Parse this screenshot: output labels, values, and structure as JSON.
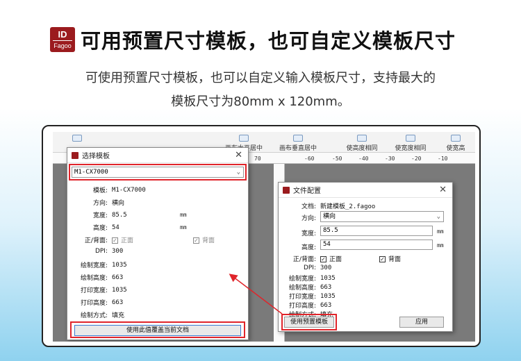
{
  "header": {
    "logo_top": "ID",
    "logo_bottom": "Fagoo",
    "title": "可用预置尺寸模板，也可自定义模板尺寸",
    "subtitle_line1": "可使用预置尺寸模板，也可以自定义输入模板尺寸，支持最大的",
    "subtitle_line2": "模板尺寸为80mm x 120mm。"
  },
  "toolbar": {
    "items": [
      "画布水平居中",
      "画布垂直居中",
      "使高度相同",
      "使宽度相同",
      "使宽高"
    ]
  },
  "ruler": {
    "ticks_left": [
      "70"
    ],
    "ticks_right": [
      "-60",
      "-50",
      "-40",
      "-30",
      "-20",
      "-10"
    ]
  },
  "template_dialog": {
    "title": "选择模板",
    "close": "✕",
    "selected": "M1-CX7000",
    "rows": [
      {
        "label": "模板:",
        "value": "M1-CX7000"
      },
      {
        "label": "方向:",
        "value": "横向"
      },
      {
        "label": "宽度:",
        "value": "85.5",
        "unit": "mm"
      },
      {
        "label": "高度:",
        "value": "54",
        "unit": "mm"
      },
      {
        "label": "DPI:",
        "value": "300"
      },
      {
        "label": "绘制宽度:",
        "value": "1035"
      },
      {
        "label": "绘制高度:",
        "value": "663"
      },
      {
        "label": "打印宽度:",
        "value": "1035"
      },
      {
        "label": "打印高度:",
        "value": "663"
      },
      {
        "label": "绘制方式:",
        "value": "填充"
      }
    ],
    "sides_label": "正/背面:",
    "front": "正面",
    "back": "背面",
    "apply_button": "使用此值覆盖当前文档"
  },
  "file_dialog": {
    "title": "文件配置",
    "close": "✕",
    "doc_label": "文档:",
    "doc_value": "新建模板_2.fagoo",
    "orientation_label": "方向:",
    "orientation_value": "横向",
    "width_label": "宽度:",
    "width_value": "85.5",
    "height_label": "高度:",
    "height_value": "54",
    "unit": "mm",
    "sides_label": "正/背面:",
    "front": "正面",
    "back": "背面",
    "rows": [
      {
        "label": "DPI:",
        "value": "300"
      },
      {
        "label": "绘制宽度:",
        "value": "1035"
      },
      {
        "label": "绘制高度:",
        "value": "663"
      },
      {
        "label": "打印宽度:",
        "value": "1035"
      },
      {
        "label": "打印高度:",
        "value": "663"
      },
      {
        "label": "绘制方式:",
        "value": "填充"
      }
    ],
    "preset_button": "使用预置模板",
    "apply_button": "应用"
  },
  "colors": {
    "brand": "#9b1b1e",
    "highlight": "#e0242a"
  }
}
